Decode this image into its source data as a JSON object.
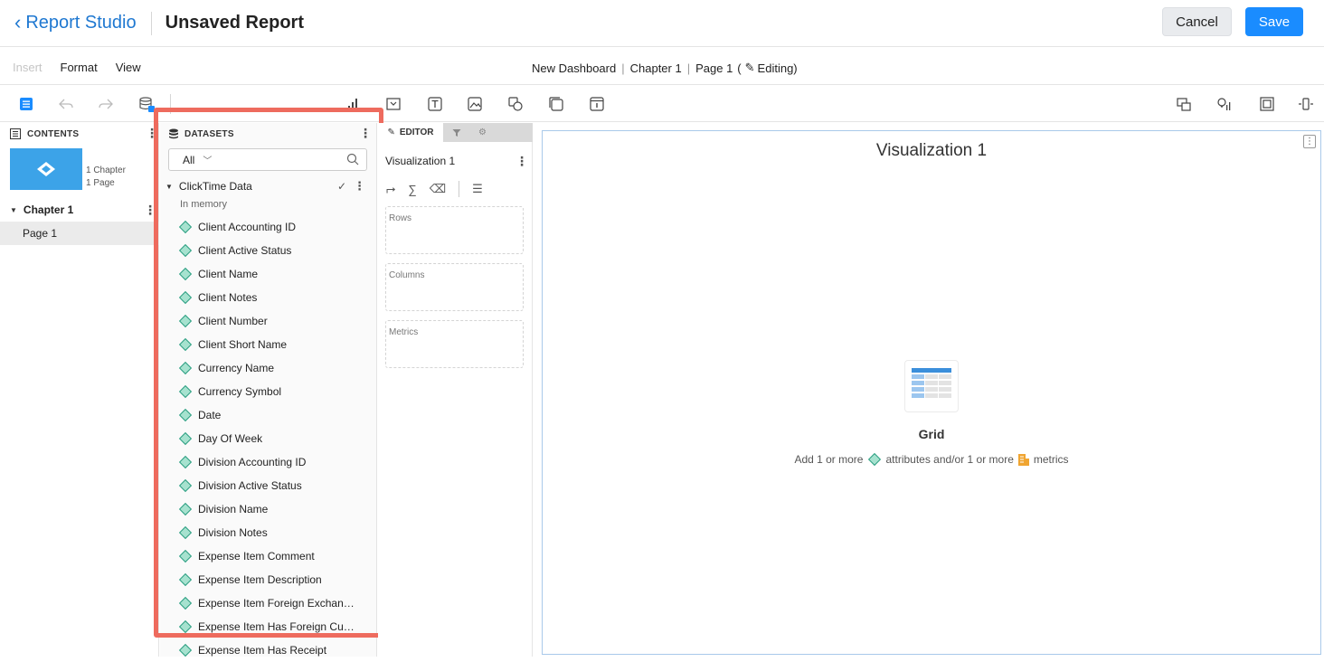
{
  "header": {
    "back_label": "Report Studio",
    "title": "Unsaved Report",
    "cancel_label": "Cancel",
    "save_label": "Save"
  },
  "menu": {
    "items": [
      "Insert",
      "Format",
      "View"
    ],
    "breadcrumb": {
      "dashboard": "New Dashboard",
      "chapter": "Chapter 1",
      "page": "Page 1",
      "mode": "Editing"
    }
  },
  "contents": {
    "heading": "CONTENTS",
    "meta_line1": "1 Chapter",
    "meta_line2": "1 Page",
    "chapter": "Chapter 1",
    "page": "Page 1"
  },
  "datasets": {
    "heading": "DATASETS",
    "filter": "All",
    "source": "ClickTime Data",
    "source_sub": "In memory",
    "items": [
      "Client Accounting ID",
      "Client Active Status",
      "Client Name",
      "Client Notes",
      "Client Number",
      "Client Short Name",
      "Currency Name",
      "Currency Symbol",
      "Date",
      "Day Of Week",
      "Division Accounting ID",
      "Division Active Status",
      "Division Name",
      "Division Notes",
      "Expense Item Comment",
      "Expense Item Description",
      "Expense Item Foreign Exchan…",
      "Expense Item Has Foreign Cu…",
      "Expense Item Has Receipt"
    ]
  },
  "editor": {
    "tab_label": "EDITOR",
    "title": "Visualization 1",
    "zones": [
      "Rows",
      "Columns",
      "Metrics"
    ]
  },
  "canvas": {
    "title": "Visualization 1",
    "viz_type": "Grid",
    "hint_prefix": "Add 1 or more",
    "hint_attr": "attributes and/or 1 or more",
    "hint_metrics": "metrics"
  },
  "colors": {
    "accent": "#1a8cff",
    "highlight": "#ee6b5e",
    "attribute": "#a6e2cf",
    "metric": "#f0a531"
  }
}
